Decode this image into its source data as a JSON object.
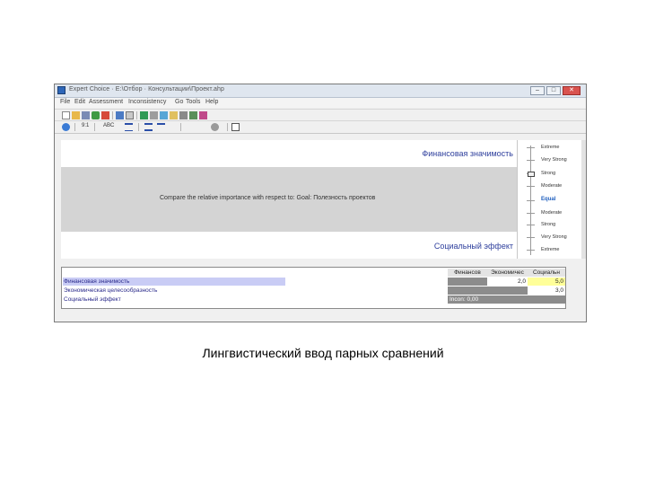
{
  "window": {
    "title": "Expert Choice · E:\\Отбор · Консультации\\Проект.ahp",
    "min_label": "–",
    "max_label": "□",
    "close_label": "✕"
  },
  "menubar": {
    "items": [
      "File",
      "Edit",
      "Assessment",
      "Inconsistency",
      "Go",
      "Tools",
      "Help"
    ]
  },
  "toolbar2": {
    "ratio_label": "9:1",
    "abc_label": "ABC"
  },
  "compare": {
    "top_criterion": "Финансовая значимость",
    "prompt": "Compare the relative importance with respect to: Goal: Полезность проектов",
    "bottom_criterion": "Социальный эффект"
  },
  "scale": {
    "items": [
      "Extreme",
      "Very Strong",
      "Strong",
      "Moderate",
      "Equal",
      "Moderate",
      "Strong",
      "Very Strong",
      "Extreme"
    ],
    "position": "Strong (top criterion)"
  },
  "matrix": {
    "columns": [
      "Финансов",
      "Экономичес",
      "Социальн"
    ],
    "rows": [
      {
        "label": "Финансовая значимость",
        "cells": [
          "",
          "2,0",
          "5,0"
        ]
      },
      {
        "label": "Экономическая целесообразность",
        "cells": [
          "",
          "",
          "3,0"
        ]
      },
      {
        "label": "Социальный эффект",
        "cells": [
          "Incon: 0,00",
          "",
          ""
        ]
      }
    ],
    "highlight_color": "#ffff99",
    "selected_row_color": "#c9ccf5"
  },
  "caption": "Лингвистический ввод парных сравнений"
}
